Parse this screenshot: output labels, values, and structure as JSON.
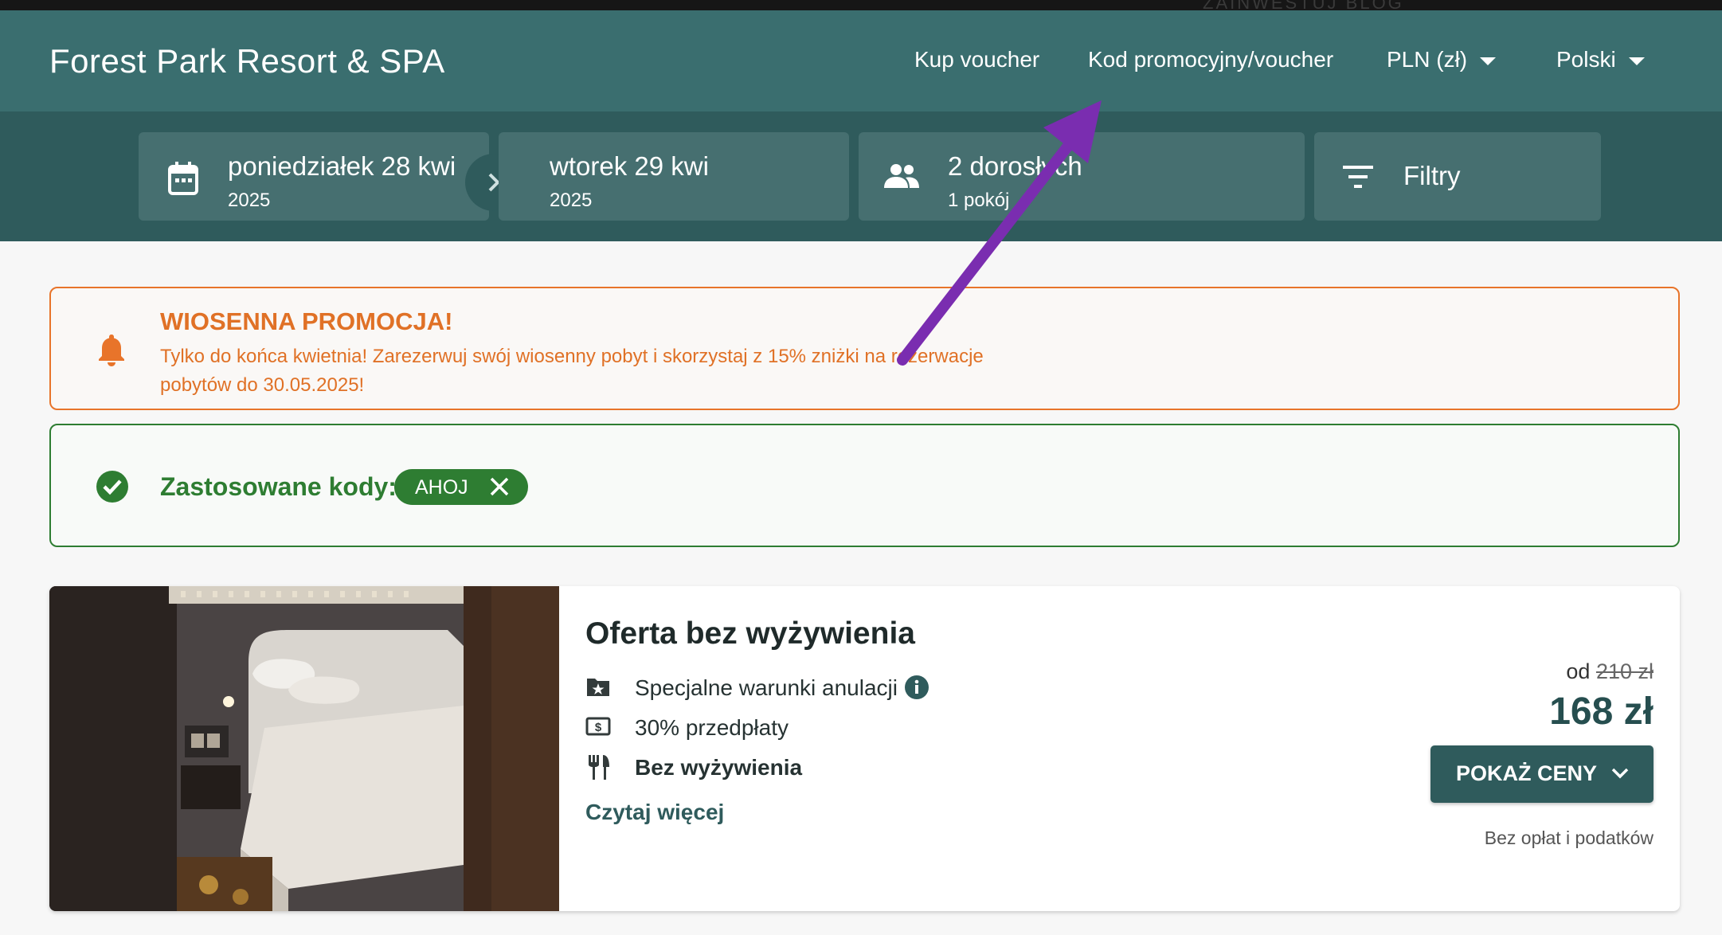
{
  "header": {
    "brand": "Forest Park Resort & SPA",
    "nav": {
      "buy_voucher": "Kup voucher",
      "promo_code": "Kod promocyjny/voucher",
      "currency": "PLN (zł)",
      "language": "Polski"
    },
    "topstrip_faded": "ZAINWESTUJ   BLOG"
  },
  "search": {
    "checkin": {
      "day": "poniedziałek 28 kwi",
      "year": "2025"
    },
    "checkout": {
      "day": "wtorek 29 kwi",
      "year": "2025"
    },
    "guests": {
      "adults": "2 dorosłych",
      "rooms": "1 pokój"
    },
    "filters": "Filtry"
  },
  "promo": {
    "title": "WIOSENNA PROMOCJA!",
    "text": "Tylko do końca kwietnia! Zarezerwuj swój wiosenny pobyt i skorzystaj z 15% zniżki na rezerwacje pobytów do 30.05.2025!",
    "color": "#e07126"
  },
  "codes": {
    "label": "Zastosowane kody:",
    "applied": [
      "AHOJ"
    ],
    "color": "#2e7d32"
  },
  "offer": {
    "title": "Oferta bez wyżywienia",
    "features": [
      {
        "icon": "star-folder-icon",
        "label": "Specjalne warunki anulacji"
      },
      {
        "icon": "cash-icon",
        "label": "30% przedpłaty"
      },
      {
        "icon": "cutlery-icon",
        "label": "Bez wyżywienia"
      }
    ],
    "read_more": "Czytaj więcej",
    "price_prefix": "od",
    "old_price": "210 zł",
    "price": "168 zł",
    "button": "POKAŻ CENY",
    "tax_note": "Bez opłat i podatków"
  },
  "colors": {
    "header": "#3a6e6f",
    "searchbar": "#2f5b5c",
    "annotation_arrow": "#7a2db0"
  }
}
